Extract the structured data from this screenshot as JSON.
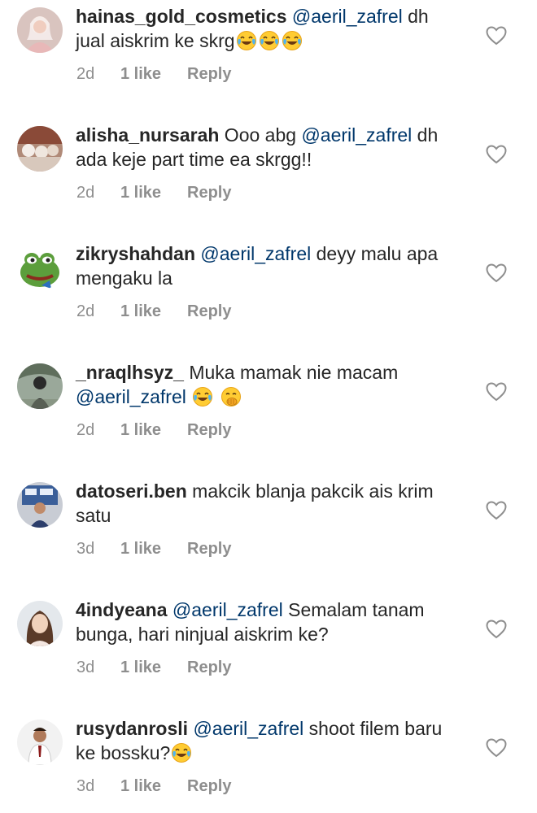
{
  "mention": "@aeril_zafrel",
  "reply_label": "Reply",
  "comments": [
    {
      "username": "hainas_gold_cosmetics",
      "text_before": "",
      "text_after": " dh jual aiskrim ke skrg",
      "time": "2d",
      "likes": "1 like",
      "emojis_after": [
        "face-with-tears-of-joy",
        "face-with-tears-of-joy",
        "face-with-tears-of-joy"
      ]
    },
    {
      "username": "alisha_nursarah",
      "text_before": " Ooo abg ",
      "text_after": " dh ada keje part time ea skrgg!!",
      "time": "2d",
      "likes": "1 like",
      "emojis_after": []
    },
    {
      "username": "zikryshahdan",
      "text_before": "",
      "text_after": "  deyy malu apa mengaku la",
      "time": "2d",
      "likes": "1 like",
      "emojis_after": []
    },
    {
      "username": "_nraqlhsyz_",
      "text_before": " Muka mamak nie macam ",
      "text_after": " ",
      "time": "2d",
      "likes": "1 like",
      "emojis_after": [
        "face-with-tears-of-joy",
        "face-with-hand-over-mouth"
      ]
    },
    {
      "username": "datoseri.ben",
      "text_before": " makcik blanja pakcik ais krim satu",
      "text_after": "",
      "time": "3d",
      "likes": "1 like",
      "no_mention": true,
      "emojis_after": []
    },
    {
      "username": "4indyeana",
      "text_before": "",
      "text_after": "  Semalam tanam bunga, hari ninjual aiskrim ke?",
      "time": "3d",
      "likes": "1 like",
      "emojis_after": []
    },
    {
      "username": "rusydanrosli",
      "text_before": "",
      "text_after": " shoot filem baru ke bossku?",
      "time": "3d",
      "likes": "1 like",
      "emojis_after": [
        "face-with-tears-of-joy"
      ]
    }
  ],
  "colors": {
    "text": "#262626",
    "mention": "#00376b",
    "meta": "#8e8e8e"
  },
  "icons": {
    "like": "heart-outline-icon"
  }
}
